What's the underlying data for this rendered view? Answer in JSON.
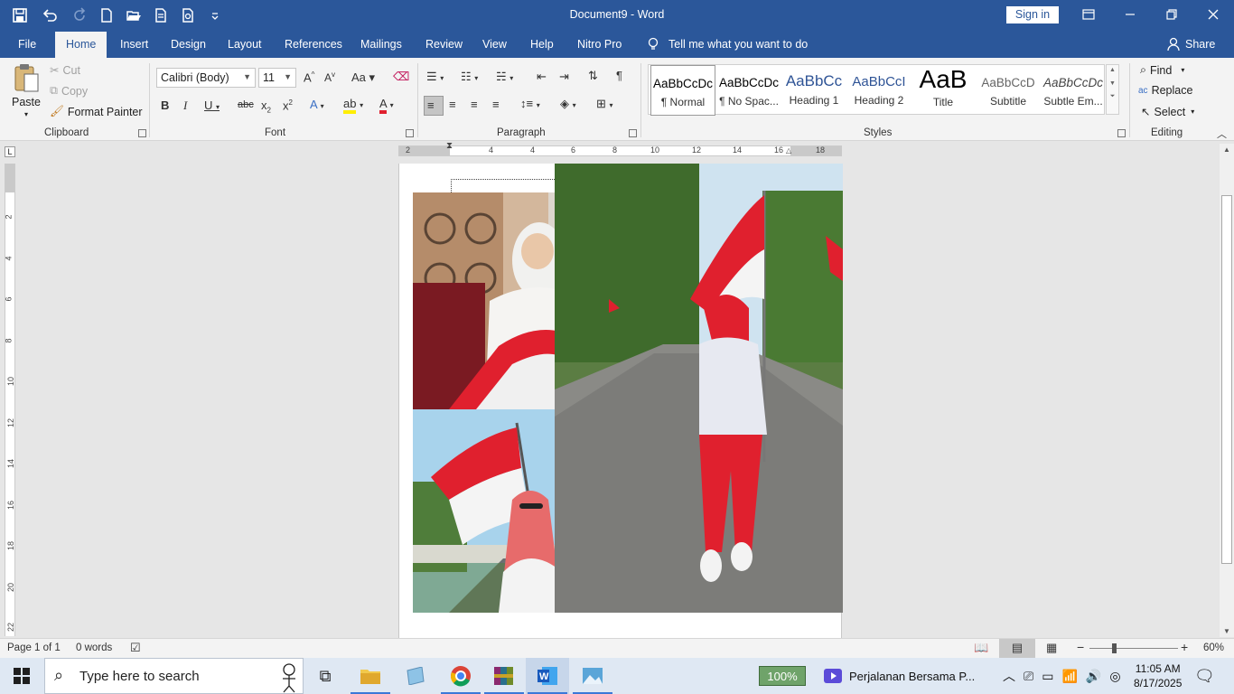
{
  "window": {
    "title": "Document9 - Word",
    "sign_in": "Sign in"
  },
  "tabs": [
    "File",
    "Home",
    "Insert",
    "Design",
    "Layout",
    "References",
    "Mailings",
    "Review",
    "View",
    "Help",
    "Nitro Pro"
  ],
  "tell_me": "Tell me what you want to do",
  "share": "Share",
  "clipboard": {
    "paste": "Paste",
    "cut": "Cut",
    "copy": "Copy",
    "format_painter": "Format Painter",
    "label": "Clipboard"
  },
  "font": {
    "name": "Calibri (Body)",
    "size": "11",
    "label": "Font",
    "case_btn": "Aa"
  },
  "paragraph": {
    "label": "Paragraph"
  },
  "styles": {
    "label": "Styles",
    "items": [
      {
        "preview": "AaBbCcDc",
        "name": "¶ Normal"
      },
      {
        "preview": "AaBbCcDc",
        "name": "¶ No Spac..."
      },
      {
        "preview": "AaBbCc",
        "name": "Heading 1"
      },
      {
        "preview": "AaBbCcI",
        "name": "Heading 2"
      },
      {
        "preview": "AaB",
        "name": "Title"
      },
      {
        "preview": "AaBbCcD",
        "name": "Subtitle"
      },
      {
        "preview": "AaBbCcDc",
        "name": "Subtle Em..."
      }
    ]
  },
  "editing": {
    "label": "Editing",
    "find": "Find",
    "replace": "Replace",
    "select": "Select"
  },
  "ruler": {
    "h_numbers": [
      "2",
      "2",
      "4",
      "6",
      "8",
      "10",
      "12",
      "14",
      "16",
      "18"
    ],
    "v_numbers": [
      "2",
      "4",
      "6",
      "8",
      "10",
      "12",
      "14",
      "16",
      "18",
      "20",
      "22"
    ]
  },
  "status": {
    "page": "Page 1 of 1",
    "words": "0 words",
    "zoom": "60%"
  },
  "taskbar": {
    "search_placeholder": "Type here to search",
    "battery": "100%",
    "media_title": "Perjalanan Bersama P...",
    "time": "11:05 AM",
    "date": "8/17/2025"
  },
  "colors": {
    "word_blue": "#2b579a",
    "flag_red": "#e0202e",
    "flag_white": "#f7f7f7"
  }
}
